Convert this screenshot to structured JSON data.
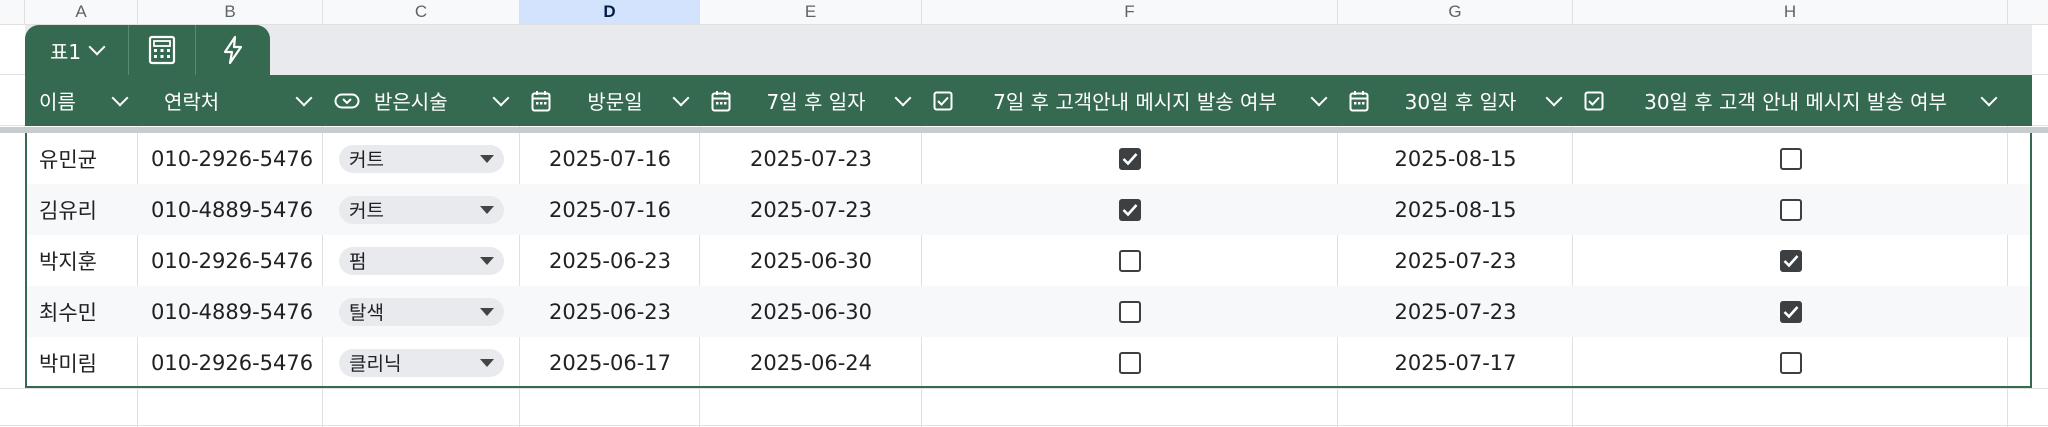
{
  "columns": [
    "A",
    "B",
    "C",
    "D",
    "E",
    "F",
    "G",
    "H"
  ],
  "selected_column": "D",
  "tab": {
    "name": "표1"
  },
  "table": {
    "headers": [
      {
        "label": "이름",
        "type_icon": ""
      },
      {
        "label": "연락처",
        "type_icon": ""
      },
      {
        "label": "받은시술",
        "type_icon": "dropdown-chip-icon"
      },
      {
        "label": "방문일",
        "type_icon": "calendar-icon"
      },
      {
        "label": "7일 후 일자",
        "type_icon": "calendar-icon"
      },
      {
        "label": "7일 후 고객안내 메시지 발송 여부",
        "type_icon": "checkbox-icon"
      },
      {
        "label": "30일 후 일자",
        "type_icon": "calendar-icon"
      },
      {
        "label": "30일 후 고객 안내 메시지 발송 여부",
        "type_icon": "checkbox-icon"
      }
    ],
    "rows": [
      {
        "name": "유민균",
        "phone": "010-2926-5476",
        "service": "커트",
        "visit": "2025-07-16",
        "d7": "2025-07-23",
        "sent7": true,
        "d30": "2025-08-15",
        "sent30": false
      },
      {
        "name": "김유리",
        "phone": "010-4889-5476",
        "service": "커트",
        "visit": "2025-07-16",
        "d7": "2025-07-23",
        "sent7": true,
        "d30": "2025-08-15",
        "sent30": false
      },
      {
        "name": "박지훈",
        "phone": "010-2926-5476",
        "service": "펌",
        "visit": "2025-06-23",
        "d7": "2025-06-30",
        "sent7": false,
        "d30": "2025-07-23",
        "sent30": true
      },
      {
        "name": "최수민",
        "phone": "010-4889-5476",
        "service": "탈색",
        "visit": "2025-06-23",
        "d7": "2025-06-30",
        "sent7": false,
        "d30": "2025-07-23",
        "sent30": true
      },
      {
        "name": "박미림",
        "phone": "010-2926-5476",
        "service": "클리닉",
        "visit": "2025-06-17",
        "d7": "2025-06-24",
        "sent7": false,
        "d30": "2025-07-17",
        "sent30": false
      }
    ]
  },
  "colors": {
    "header_bg": "#356a51",
    "selected_col_bg": "#d3e3fd"
  }
}
